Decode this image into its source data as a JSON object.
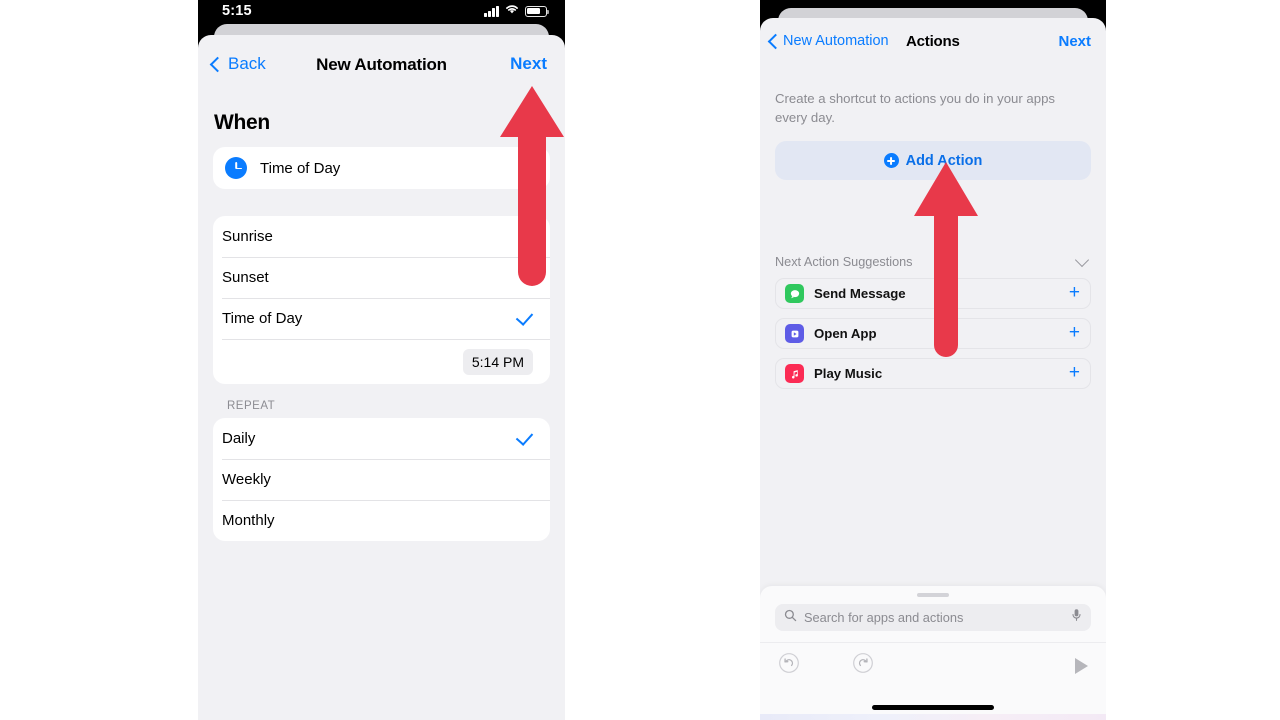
{
  "colors": {
    "accent_blue": "#0a7cff",
    "arrow_red": "#e8394a",
    "sheet_bg": "#f1f1f4",
    "card_white": "#ffffff",
    "muted_text": "#8b8b91"
  },
  "left_phone": {
    "status_bar": {
      "time": "5:15",
      "signal_icon": "cellular-bars-icon",
      "wifi_icon": "wifi-icon",
      "battery_icon": "battery-icon"
    },
    "nav": {
      "back_label": "Back",
      "title": "New Automation",
      "next_label": "Next"
    },
    "section_heading": "When",
    "trigger": {
      "icon": "clock-icon",
      "label": "Time of Day"
    },
    "trigger_options": [
      {
        "label": "Sunrise",
        "selected": false
      },
      {
        "label": "Sunset",
        "selected": false
      },
      {
        "label": "Time of Day",
        "selected": true
      }
    ],
    "selected_time": "5:14 PM",
    "repeat_group_label": "REPEAT",
    "repeat_options": [
      {
        "label": "Daily",
        "selected": true
      },
      {
        "label": "Weekly",
        "selected": false
      },
      {
        "label": "Monthly",
        "selected": false
      }
    ]
  },
  "right_phone": {
    "nav": {
      "back_label": "New Automation",
      "title": "Actions",
      "next_label": "Next"
    },
    "description": "Create a shortcut to actions you do in your apps every day.",
    "add_action_label": "Add Action",
    "suggestions_header": "Next Action Suggestions",
    "suggestions": [
      {
        "label": "Send Message",
        "icon": "messages-app-icon",
        "icon_color": "#30c85e",
        "glyph": "●",
        "add": "+"
      },
      {
        "label": "Open App",
        "icon": "open-app-icon",
        "icon_color": "#5e5ce6",
        "glyph": "■",
        "add": "+"
      },
      {
        "label": "Play Music",
        "icon": "music-app-icon",
        "icon_color": "#fb2b54",
        "glyph": "♪",
        "add": "+"
      }
    ],
    "search": {
      "placeholder": "Search for apps and actions",
      "search_icon": "search-icon",
      "mic_icon": "microphone-icon"
    },
    "toolbar": {
      "undo_icon": "undo-icon",
      "redo_icon": "redo-icon",
      "play_icon": "play-icon"
    }
  },
  "annotations": {
    "left_arrow": {
      "points_to": "Next",
      "color": "#e8394a"
    },
    "right_arrow": {
      "points_to": "Add Action",
      "color": "#e8394a"
    }
  }
}
